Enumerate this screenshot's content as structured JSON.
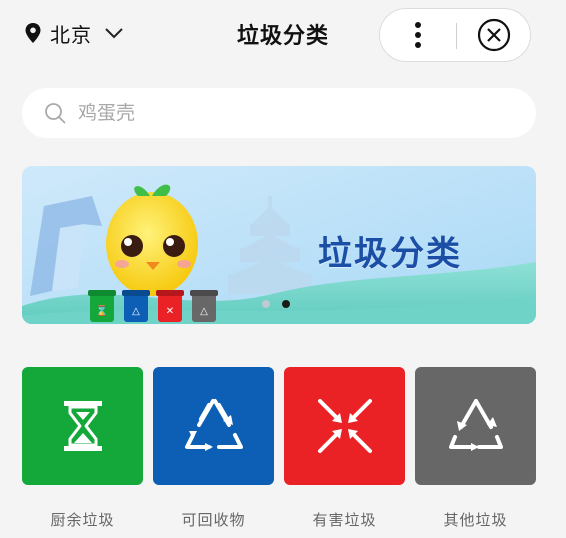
{
  "header": {
    "city": "北京",
    "title": "垃圾分类"
  },
  "search": {
    "placeholder": "鸡蛋壳"
  },
  "banner": {
    "title": "垃圾分类",
    "slide_count": 2,
    "active_slide": 2
  },
  "categories": [
    {
      "label": "厨余垃圾",
      "color": "#14a83b",
      "icon": "hourglass-icon"
    },
    {
      "label": "可回收物",
      "color": "#0d5fb5",
      "icon": "recycle-icon"
    },
    {
      "label": "有害垃圾",
      "color": "#ea2226",
      "icon": "hazard-arrows-icon"
    },
    {
      "label": "其他垃圾",
      "color": "#676767",
      "icon": "other-recycle-icon"
    }
  ]
}
